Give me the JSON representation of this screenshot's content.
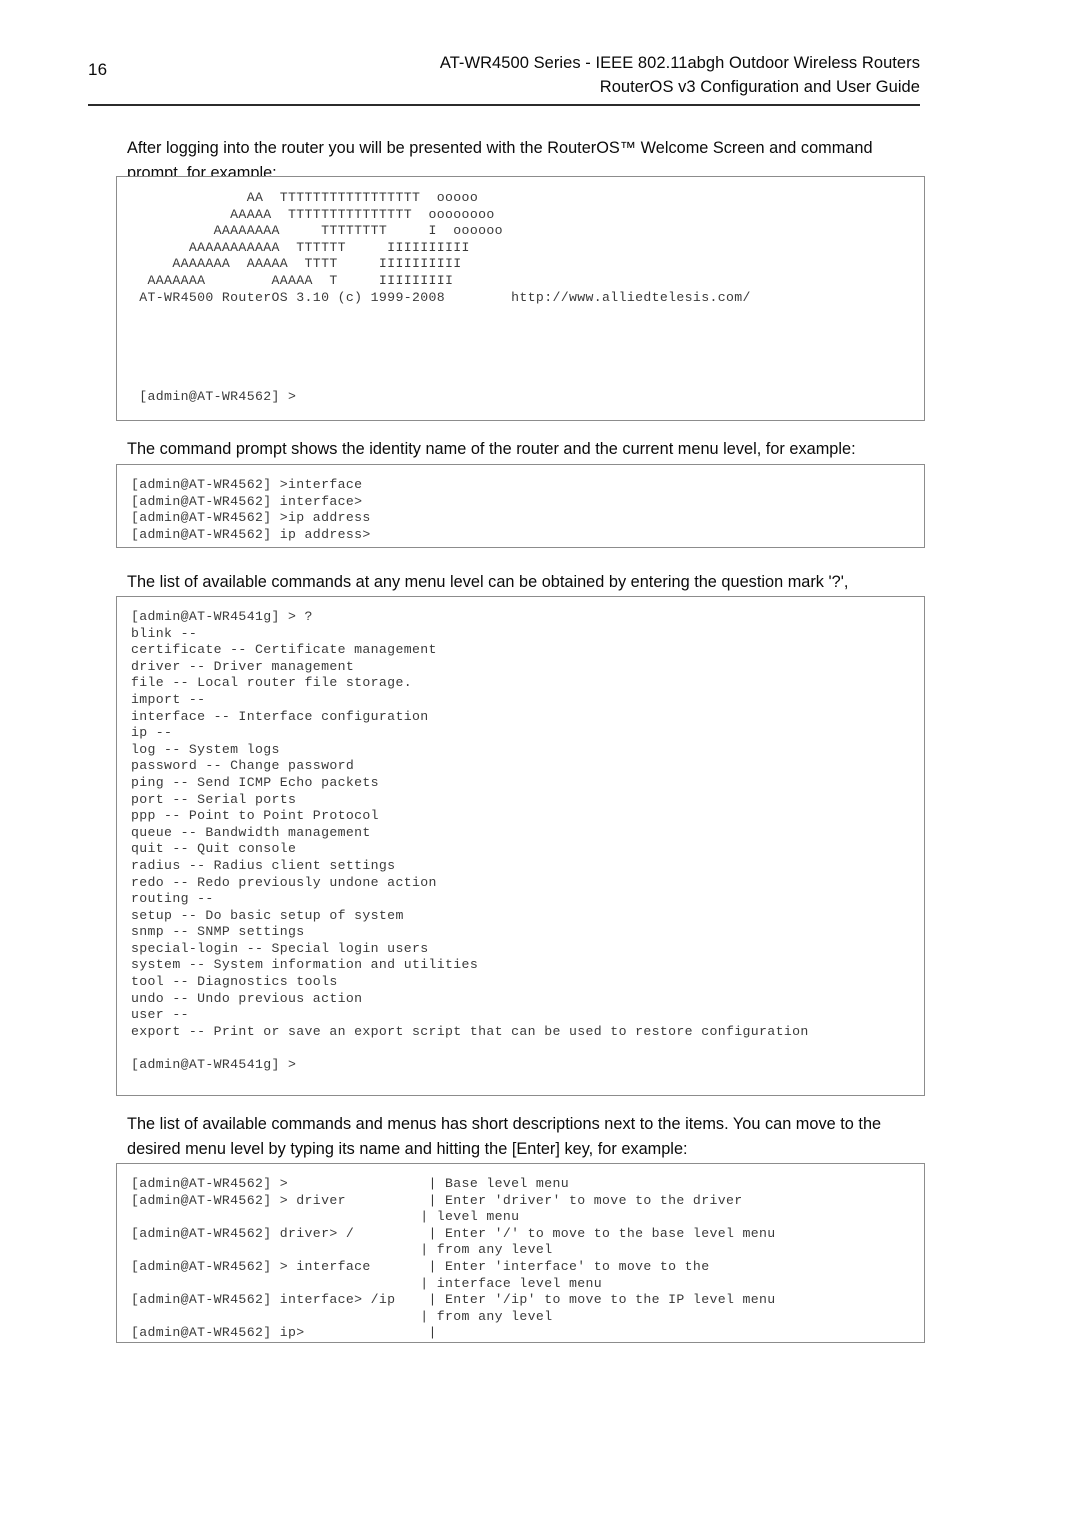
{
  "header": {
    "page_number": "16",
    "title_line1": "AT-WR4500 Series - IEEE 802.11abgh Outdoor Wireless Routers",
    "title_line2": "RouterOS v3 Configuration and User Guide"
  },
  "sections": [
    {
      "paragraph": "After logging into the router you will be presented with the RouterOS™ Welcome Screen and command prompt, for example:",
      "code": "              AA  TTTTTTTTTTTTTTTTT  ooooo\n            AAAAA  TTTTTTTTTTTTTTT  oooooooo\n          AAAAAAAA     TTTTTTTT     I  oooooo\n       AAAAAAAAAAA  TTTTTT     IIIIIIIIII\n     AAAAAAA  AAAAA  TTTT     IIIIIIIIII\n  AAAAAAA        AAAAA  T     IIIIIIIII\n AT-WR4500 RouterOS 3.10 (c) 1999-2008        http://www.alliedtelesis.com/\n\n\n\n\n\n [admin@AT-WR4562] >"
    },
    {
      "paragraph": "The command prompt shows the identity name of the router and the current menu level, for example:",
      "code": "[admin@AT-WR4562] >interface\n[admin@AT-WR4562] interface>\n[admin@AT-WR4562] >ip address\n[admin@AT-WR4562] ip address>"
    },
    {
      "paragraph": "The list of available commands at any menu level can be obtained by entering the question mark '?',",
      "code": "[admin@AT-WR4541g] > ?\nblink --\ncertificate -- Certificate management\ndriver -- Driver management\nfile -- Local router file storage.\nimport --\ninterface -- Interface configuration\nip --\nlog -- System logs\npassword -- Change password\nping -- Send ICMP Echo packets\nport -- Serial ports\nppp -- Point to Point Protocol\nqueue -- Bandwidth management\nquit -- Quit console\nradius -- Radius client settings\nredo -- Redo previously undone action\nrouting --\nsetup -- Do basic setup of system\nsnmp -- SNMP settings\nspecial-login -- Special login users\nsystem -- System information and utilities\ntool -- Diagnostics tools\nundo -- Undo previous action\nuser --\nexport -- Print or save an export script that can be used to restore configuration\n\n[admin@AT-WR4541g] >"
    },
    {
      "paragraph": "The list of available commands and menus has short descriptions next to the items. You can move to the desired menu level by typing its name and hitting the [Enter] key, for example:",
      "code": "[admin@AT-WR4562] >                 | Base level menu\n[admin@AT-WR4562] > driver          | Enter 'driver' to move to the driver\n                                   | level menu\n[admin@AT-WR4562] driver> /         | Enter '/' to move to the base level menu\n                                   | from any level\n[admin@AT-WR4562] > interface       | Enter 'interface' to move to the\n                                   | interface level menu\n[admin@AT-WR4562] interface> /ip    | Enter '/ip' to move to the IP level menu\n                                   | from any level\n[admin@AT-WR4562] ip>               |"
    }
  ]
}
